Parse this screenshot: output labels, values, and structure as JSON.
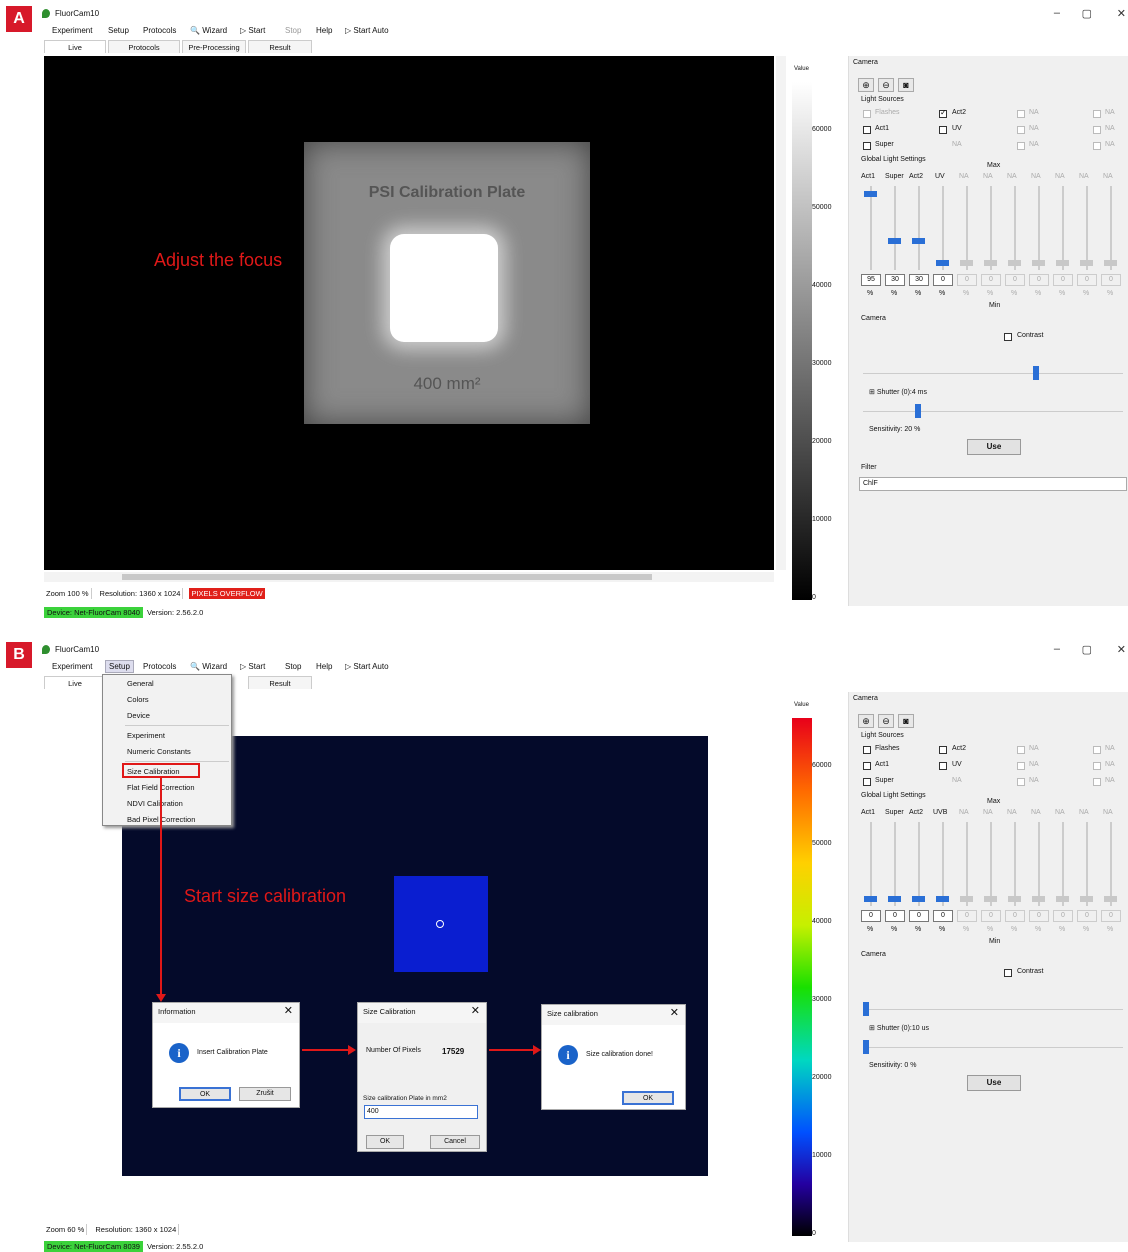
{
  "panels": {
    "a": {
      "label": "A",
      "annotation": "Adjust the focus",
      "status": {
        "zoom": "Zoom 100 %",
        "resolution": "Resolution: 1360 x 1024",
        "warning": "PIXELS OVERFLOW",
        "device": "Device: Net-FluorCam 8040",
        "version": "Version: 2.56.2.0"
      },
      "plate": {
        "title": "PSI Calibration Plate",
        "area": "400 mm²"
      },
      "tick_labels": [
        "60000",
        "50000",
        "40000",
        "30000",
        "20000",
        "10000",
        "0"
      ],
      "levels": [
        "95",
        "30",
        "30",
        "0",
        "0",
        "0",
        "0",
        "0",
        "0",
        "0",
        "0"
      ],
      "light_checks": {
        "act2": true
      },
      "shutter": "Shutter (0):4 ms",
      "sensitivity": "Sensitivity: 20 %"
    },
    "b": {
      "label": "B",
      "annotation": "Start size calibration",
      "status": {
        "zoom": "Zoom 60 %",
        "resolution": "Resolution: 1360 x 1024",
        "device": "Device: Net-FluorCam 8039",
        "version": "Version: 2.55.2.0"
      },
      "tick_labels": [
        "60000",
        "50000",
        "40000",
        "30000",
        "20000",
        "10000",
        "0"
      ],
      "levels": [
        "0",
        "0",
        "0",
        "0",
        "0",
        "0",
        "0",
        "0",
        "0",
        "0",
        "0"
      ],
      "shutter": "Shutter (0):10 us",
      "sensitivity": "Sensitivity: 0 %",
      "setup_menu": [
        "General",
        "Colors",
        "Device",
        "Experiment",
        "Numeric Constants",
        "Size Calibration",
        "Flat Field Correction",
        "NDVI Calibration",
        "Bad Pixel Correction"
      ],
      "dialog_info": {
        "title": "Information",
        "message": "Insert Calibration Plate",
        "ok": "OK",
        "cancel": "Zrušit"
      },
      "dialog_size": {
        "title": "Size Calibration",
        "pixels_label": "Number Of Pixels",
        "pixels_value": "17529",
        "plate_label": "Size calibration Plate in mm2",
        "plate_value": "400",
        "ok": "OK",
        "cancel": "Cancel"
      },
      "dialog_done": {
        "title": "Size calibration",
        "message": "Size calibration done!",
        "ok": "OK"
      }
    }
  },
  "app": {
    "title": "FluorCam10",
    "minimize": "–",
    "maximize": "▢",
    "close": "✕"
  },
  "menu": {
    "experiment": "Experiment",
    "setup": "Setup",
    "protocols": "Protocols",
    "wizard": "Wizard",
    "start": "Start",
    "stop": "Stop",
    "help": "Help",
    "start_auto": "Start Auto"
  },
  "tabs": {
    "live": "Live",
    "protocols": "Protocols",
    "preprocessing": "Pre-Processing",
    "result": "Result"
  },
  "colorbar_title": "Value",
  "side": {
    "camera_tab": "Camera",
    "light_sources": "Light Sources",
    "flashes": "Flashes",
    "act1": "Act1",
    "super": "Super",
    "act2": "Act2",
    "uv": "UV",
    "na": "NA",
    "global_light": "Global Light Settings",
    "max": "Max",
    "min": "Min",
    "col_act1": "Act1",
    "col_super": "Super",
    "col_act2": "Act2",
    "col_uv_a": "UV",
    "col_uv_b": "UVB",
    "percent": "%",
    "camera": "Camera",
    "contrast": "Contrast",
    "use": "Use",
    "filter": "Filter",
    "filter_value": "ChlF",
    "icon_zoom_in": "zoom-in-icon",
    "icon_zoom_out": "zoom-out-icon",
    "icon_camera": "camera-icon"
  },
  "colors": {
    "accent": "#2a6fd6",
    "annotation": "#e01818",
    "device": "#3bd23b",
    "warning": "#e0201a"
  }
}
